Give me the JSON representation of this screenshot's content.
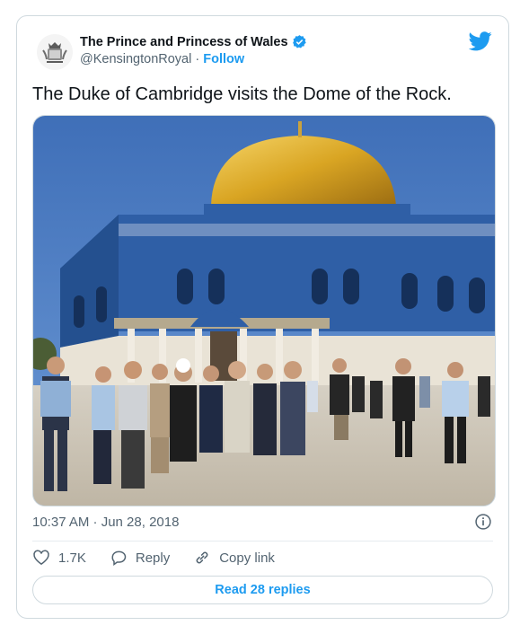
{
  "tweet": {
    "author_name": "The Prince and Princess of Wales",
    "handle": "@KensingtonRoyal",
    "separator": "·",
    "follow_label": "Follow",
    "text": "The Duke of Cambridge visits the Dome of the Rock.",
    "timestamp": "10:37 AM · Jun 28, 2018"
  },
  "actions": {
    "like_count": "1.7K",
    "reply_label": "Reply",
    "copy_link_label": "Copy link"
  },
  "footer": {
    "read_replies_label": "Read 28 replies"
  },
  "colors": {
    "accent": "#1d9bf0",
    "secondary_text": "#536471",
    "border": "#cfd9de",
    "dome_gold": "#d7a525",
    "tile_blue": "#2f5fa6"
  },
  "icons": [
    "royal-crest-icon",
    "verified-badge-icon",
    "twitter-bird-icon",
    "info-icon",
    "heart-icon",
    "reply-icon",
    "link-icon"
  ]
}
